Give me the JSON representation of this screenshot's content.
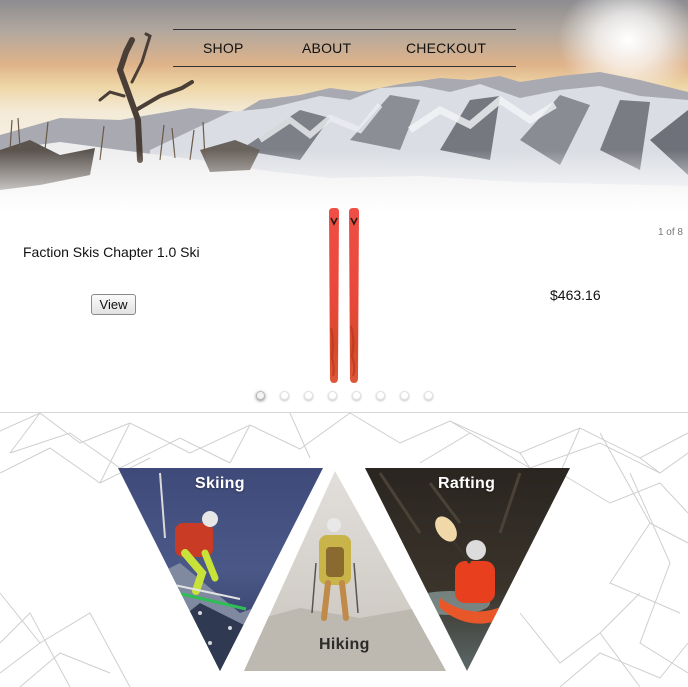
{
  "nav": {
    "items": [
      {
        "label": "SHOP"
      },
      {
        "label": "ABOUT"
      },
      {
        "label": "CHECKOUT"
      }
    ]
  },
  "product_carousel": {
    "counter": "1 of 8",
    "product_name": "Faction Skis Chapter 1.0 Ski",
    "view_button": "View",
    "price": "$463.16",
    "slide_count": 8,
    "active_slide": 1
  },
  "activities": [
    {
      "label": "Skiing"
    },
    {
      "label": "Hiking"
    },
    {
      "label": "Rafting"
    }
  ],
  "colors": {
    "ski_primary": "#e8483a",
    "ski_accent": "#c8321f",
    "nav_rule": "#333333",
    "mesh_line": "#cfcfcf"
  },
  "icons": {
    "carousel_pager": "dot-icon"
  }
}
